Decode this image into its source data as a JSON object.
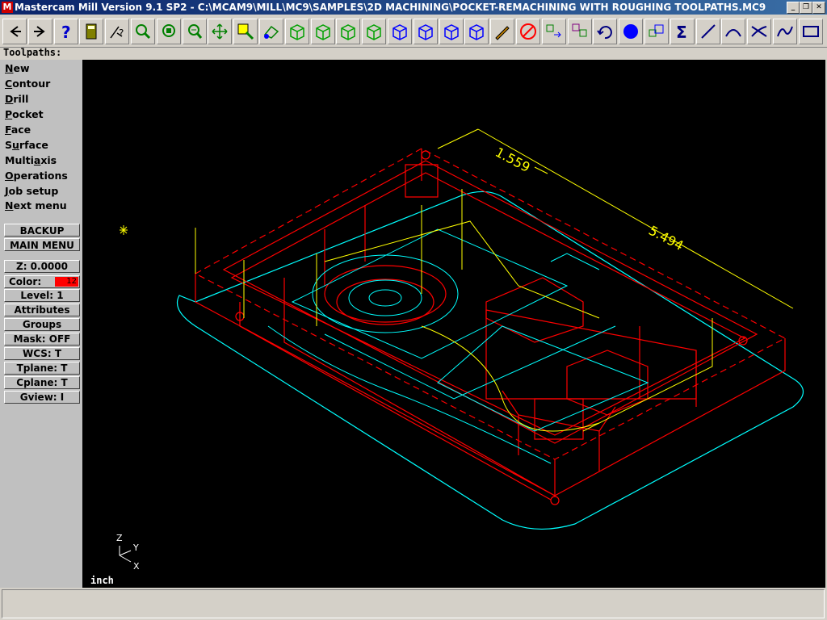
{
  "window": {
    "title": "Mastercam Mill Version 9.1 SP2 - C:\\MCAM9\\MILL\\MC9\\SAMPLES\\2D MACHINING\\POCKET-REMACHINING WITH ROUGHING TOOLPATHS.MC9",
    "icon_label": "M",
    "minimize_label": "_",
    "maximize_label": "❐",
    "close_label": "✕"
  },
  "toolbar": {
    "buttons": [
      {
        "name": "back-arrow-icon",
        "color": "#000000"
      },
      {
        "name": "forward-arrow-icon",
        "color": "#000000"
      },
      {
        "name": "help-icon",
        "color": "#0000cc"
      },
      {
        "name": "calculator-icon",
        "color": "#808000"
      },
      {
        "name": "analyze-icon",
        "color": "#000000"
      },
      {
        "name": "zoom-window-icon",
        "color": "#008000"
      },
      {
        "name": "fit-screen-icon",
        "color": "#008000"
      },
      {
        "name": "zoom-out-icon",
        "color": "#008000"
      },
      {
        "name": "pan-icon",
        "color": "#008000"
      },
      {
        "name": "zoom-target-icon",
        "color": "#008000"
      },
      {
        "name": "rotate-view-icon",
        "color": "#008000"
      },
      {
        "name": "cube-top-icon",
        "color": "#00a000"
      },
      {
        "name": "cube-front-icon",
        "color": "#00a000"
      },
      {
        "name": "cube-side-icon",
        "color": "#00a000"
      },
      {
        "name": "cube-iso-icon",
        "color": "#00a000"
      },
      {
        "name": "cube-cplane-top-icon",
        "color": "#0000ff"
      },
      {
        "name": "cube-cplane-front-icon",
        "color": "#0000ff"
      },
      {
        "name": "cube-cplane-side-icon",
        "color": "#0000ff"
      },
      {
        "name": "cube-cplane-3d-icon",
        "color": "#0000ff"
      },
      {
        "name": "pencil-icon",
        "color": "#c08000"
      },
      {
        "name": "no-delete-icon",
        "color": "#ff0000"
      },
      {
        "name": "transform-icon",
        "color": "#008000"
      },
      {
        "name": "copy-icon",
        "color": "#800080"
      },
      {
        "name": "undo-icon",
        "color": "#000080"
      },
      {
        "name": "shade-sphere-icon",
        "color": "#0000ff"
      },
      {
        "name": "layers-icon",
        "color": "#008000"
      },
      {
        "name": "sum-icon",
        "color": "#000080"
      },
      {
        "name": "line-icon",
        "color": "#000080"
      },
      {
        "name": "arc-icon",
        "color": "#000080"
      },
      {
        "name": "trim-icon",
        "color": "#000080"
      },
      {
        "name": "spline-icon",
        "color": "#000080"
      },
      {
        "name": "rectangle-icon",
        "color": "#000080"
      }
    ]
  },
  "prompt": {
    "text": "Toolpaths:"
  },
  "menu": {
    "items": [
      {
        "pre": "",
        "u": "N",
        "post": "ew"
      },
      {
        "pre": "",
        "u": "C",
        "post": "ontour"
      },
      {
        "pre": "",
        "u": "D",
        "post": "rill"
      },
      {
        "pre": "",
        "u": "P",
        "post": "ocket"
      },
      {
        "pre": "",
        "u": "F",
        "post": "ace"
      },
      {
        "pre": "S",
        "u": "u",
        "post": "rface"
      },
      {
        "pre": "Multi",
        "u": "a",
        "post": "xis"
      },
      {
        "pre": "",
        "u": "O",
        "post": "perations"
      },
      {
        "pre": "",
        "u": "J",
        "post": "ob setup"
      },
      {
        "pre": "",
        "u": "N",
        "post": "ext menu"
      }
    ],
    "backup": "BACKUP",
    "main_menu": "MAIN MENU",
    "z": "Z:  0.0000",
    "color_label": "Color:",
    "color_value": "12",
    "color_hex": "#ff0000",
    "level": "Level:  1",
    "attributes": "Attributes",
    "groups": "Groups",
    "mask": "Mask:  OFF",
    "wcs": "WCS:   T",
    "tplane": "Tplane:  T",
    "cplane": "Cplane:  T",
    "gview": "Gview:   I"
  },
  "viewport": {
    "background": "#000000",
    "dimension_1": "1.559",
    "dimension_2": "5.494",
    "axis_z": "Z",
    "axis_y": "Y",
    "axis_x": "X",
    "units": "inch",
    "colors": {
      "outline": "#00ffff",
      "part": "#ff0000",
      "tool": "#ffff00"
    }
  },
  "status": {
    "text": ""
  }
}
